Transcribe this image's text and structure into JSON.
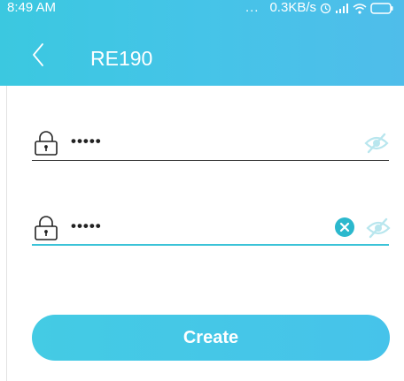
{
  "status_bar": {
    "time": "8:49 AM",
    "dots": "...",
    "network_speed": "0.3KB/s",
    "icons": [
      "alarm-icon",
      "signal-icon",
      "wifi-icon",
      "battery-icon"
    ]
  },
  "header": {
    "back_icon": "chevron-left-icon",
    "title": "RE190"
  },
  "form": {
    "password_field": {
      "icon": "lock-icon",
      "value": "•••••",
      "toggle_icon": "eye-hidden-icon"
    },
    "confirm_field": {
      "icon": "lock-icon",
      "value": "•••••",
      "clear_icon": "clear-icon",
      "toggle_icon": "eye-hidden-icon"
    }
  },
  "actions": {
    "create_label": "Create"
  },
  "colors": {
    "brand": "#45c4e8",
    "accent": "#2bb8cd",
    "eye_icon": "#b8e6ee"
  }
}
